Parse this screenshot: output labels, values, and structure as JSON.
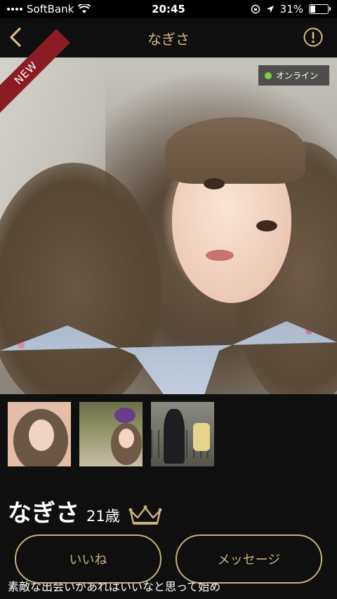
{
  "status_bar": {
    "carrier": "SoftBank",
    "time": "20:45",
    "battery": "31%",
    "battery_level": 0.31
  },
  "nav": {
    "title": "なぎさ",
    "back_icon": "chevron-left-icon",
    "report_icon": "exclamation-circle-icon"
  },
  "photo": {
    "new_label": "NEW",
    "online_label": "オンライン"
  },
  "thumbnails": [
    "photo-1",
    "photo-2",
    "photo-3"
  ],
  "profile": {
    "name": "なぎさ",
    "age": "21歳",
    "badge_icon": "crown-icon",
    "intro": "素敵な出会いがあればいいなと思って始め"
  },
  "actions": {
    "like_label": "いいね",
    "message_label": "メッセージ"
  },
  "colors": {
    "accent": "#c9b27a",
    "background": "#0f0f0f",
    "new_ribbon": "#8c1c24",
    "online": "#7ad047"
  }
}
